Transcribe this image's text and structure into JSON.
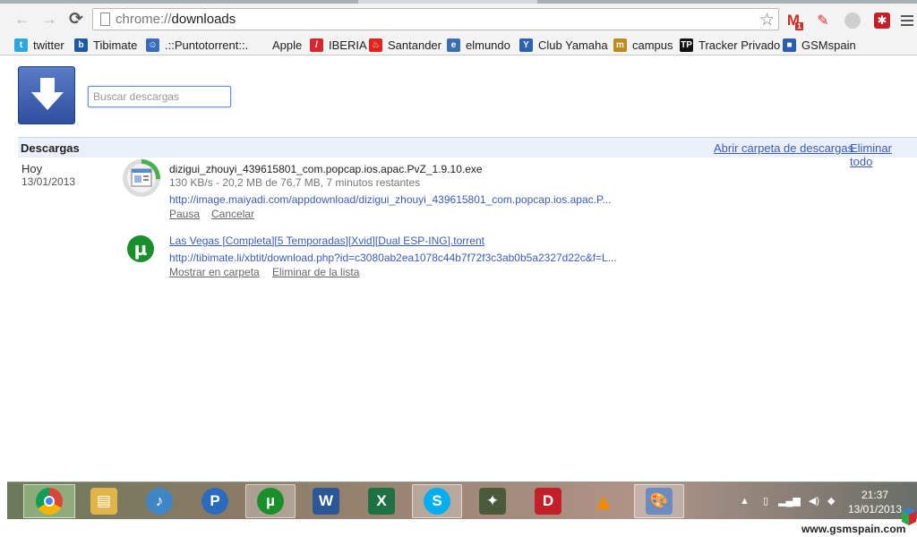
{
  "browser": {
    "url_scheme": "chrome://",
    "url_path": "downloads",
    "gmail_badge": "1"
  },
  "bookmarks": [
    {
      "label": "twitter",
      "icon": "twitter-icon",
      "color": "#2ea7e0"
    },
    {
      "label": "Tibimate",
      "icon": "tibimate-icon",
      "color": "#1c5aa6"
    },
    {
      "label": ".::Puntotorrent::.",
      "icon": "puntotorrent-icon",
      "color": "#3b6dbd"
    },
    {
      "label": "Apple",
      "icon": "apple-icon",
      "color": "#555555"
    },
    {
      "label": "IBERIA",
      "icon": "iberia-icon",
      "color": "#d7262f"
    },
    {
      "label": "Santander",
      "icon": "santander-icon",
      "color": "#e2231a"
    },
    {
      "label": "elmundo",
      "icon": "elmundo-icon",
      "color": "#3d6fb0"
    },
    {
      "label": "Club Yamaha",
      "icon": "yamaha-icon",
      "color": "#2d62b3"
    },
    {
      "label": "campus",
      "icon": "campus-icon",
      "color": "#c28a1e"
    },
    {
      "label": "Tracker Privado",
      "icon": "tracker-icon",
      "color": "#111111"
    },
    {
      "label": "GSMspain",
      "icon": "gsmspain-icon",
      "color": "#2b5db0"
    }
  ],
  "downloads": {
    "search_placeholder": "Buscar descargas",
    "section_title": "Descargas",
    "open_folder_label": "Abrir carpeta de descargas",
    "clear_all_label": "Eliminar todo",
    "date_label": "Hoy",
    "date_value": "13/01/2013",
    "items": [
      {
        "filename": "dizigui_zhouyi_439615801_com.popcap.ios.apac.PvZ_1.9.10.exe",
        "status": "130 KB/s - 20,2 MB de 76,7 MB, 7 minutos restantes",
        "url": "http://image.maiyadi.com/appdownload/dizigui_zhouyi_439615801_com.popcap.ios.apac.P...",
        "progress": 0.26,
        "actions": [
          "Pausa",
          "Cancelar"
        ]
      },
      {
        "filename": "Las Vegas [Completa][5 Temporadas][Xvid][Dual ESP-ING].torrent",
        "url": "http://tibimate.li/xbtit/download.php?id=c3080ab2ea1078c44b7f72f3c3ab0b5a2327d22c&f=L...",
        "actions": [
          "Mostrar en carpeta",
          "Eliminar de la lista"
        ]
      }
    ]
  },
  "taskbar": {
    "apps": [
      {
        "name": "chrome-taskbar-icon",
        "color": "#4caf50"
      },
      {
        "name": "file-explorer-taskbar-icon",
        "color": "#e2b54a"
      },
      {
        "name": "itunes-taskbar-icon",
        "color": "#3f86c7"
      },
      {
        "name": "pandora-taskbar-icon",
        "color": "#2a6bbd"
      },
      {
        "name": "utorrent-taskbar-icon",
        "color": "#1a8e2a"
      },
      {
        "name": "word-taskbar-icon",
        "color": "#2b5797"
      },
      {
        "name": "excel-taskbar-icon",
        "color": "#1e7145"
      },
      {
        "name": "skype-taskbar-icon",
        "color": "#00aff0"
      },
      {
        "name": "game-taskbar-icon",
        "color": "#4a5a3a"
      },
      {
        "name": "daemon-tools-taskbar-icon",
        "color": "#c4202a"
      },
      {
        "name": "vlc-taskbar-icon",
        "color": "#f08a00"
      },
      {
        "name": "paint-taskbar-icon",
        "color": "#6c8cbf"
      }
    ],
    "time": "21:37",
    "date": "13/01/2013"
  },
  "watermark": "www.gsmspain.com"
}
